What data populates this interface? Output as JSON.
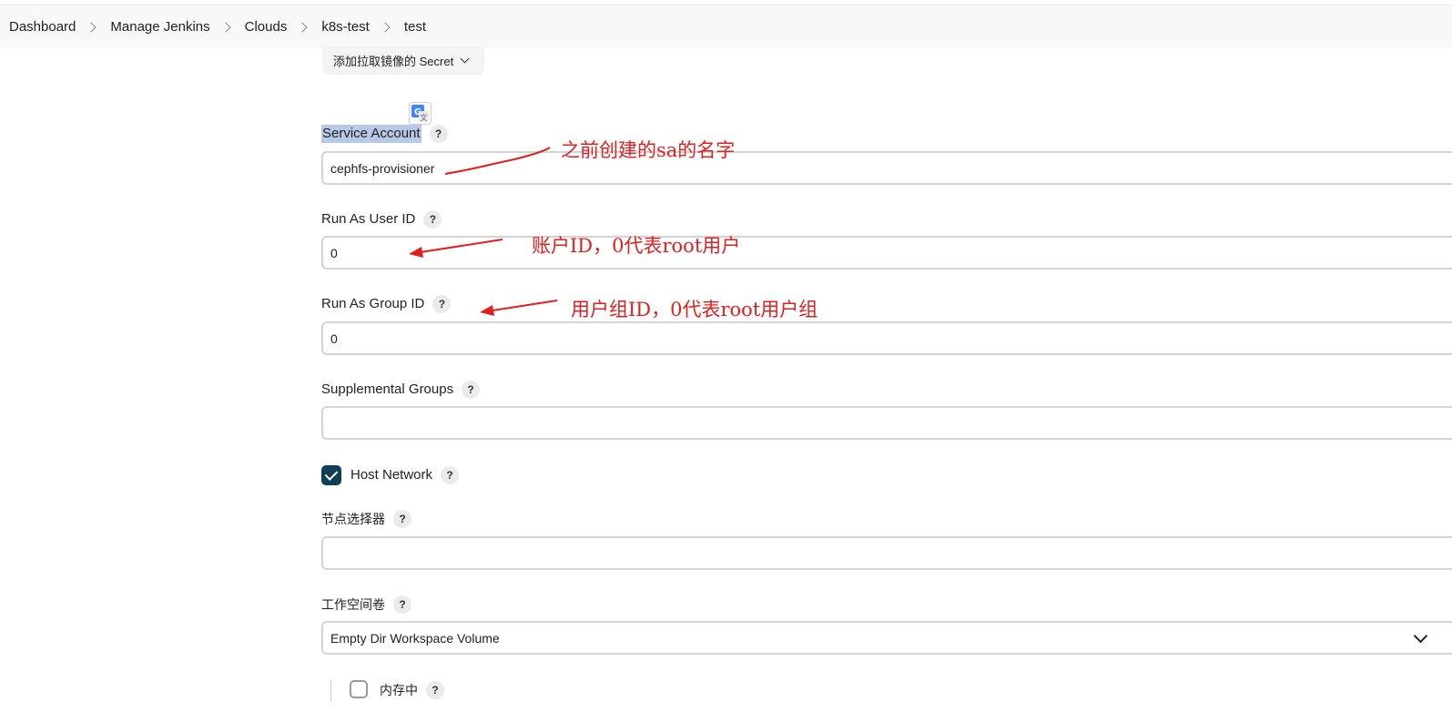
{
  "breadcrumb": [
    "Dashboard",
    "Manage Jenkins",
    "Clouds",
    "k8s-test",
    "test"
  ],
  "pull_secret_button": {
    "label": "添加拉取镜像的 Secret",
    "icon": "chevron-down-icon"
  },
  "translate_icon": "google-translate-icon",
  "help_glyph": "?",
  "fields": {
    "service_account": {
      "label": "Service Account",
      "value": "cephfs-provisioner"
    },
    "run_as_user": {
      "label": "Run As User ID",
      "value": "0"
    },
    "run_as_group": {
      "label": "Run As Group ID",
      "value": "0"
    },
    "supplemental_groups": {
      "label": "Supplemental Groups",
      "value": ""
    },
    "host_network": {
      "label": "Host Network",
      "checked": true
    },
    "node_selector": {
      "label": "节点选择器",
      "value": ""
    },
    "workspace_volume": {
      "label": "工作空间卷",
      "value": "Empty Dir Workspace Volume"
    },
    "in_memory": {
      "label": "内存中",
      "checked": false
    }
  },
  "annotations": {
    "sa": "之前创建的sa的名字",
    "user": "账户ID，0代表root用户",
    "group": "用户组ID，0代表root用户组"
  },
  "colors": {
    "annotation": "#e21f1f",
    "checkbox": "#0f3e58",
    "highlight": "#b7c9e6"
  }
}
